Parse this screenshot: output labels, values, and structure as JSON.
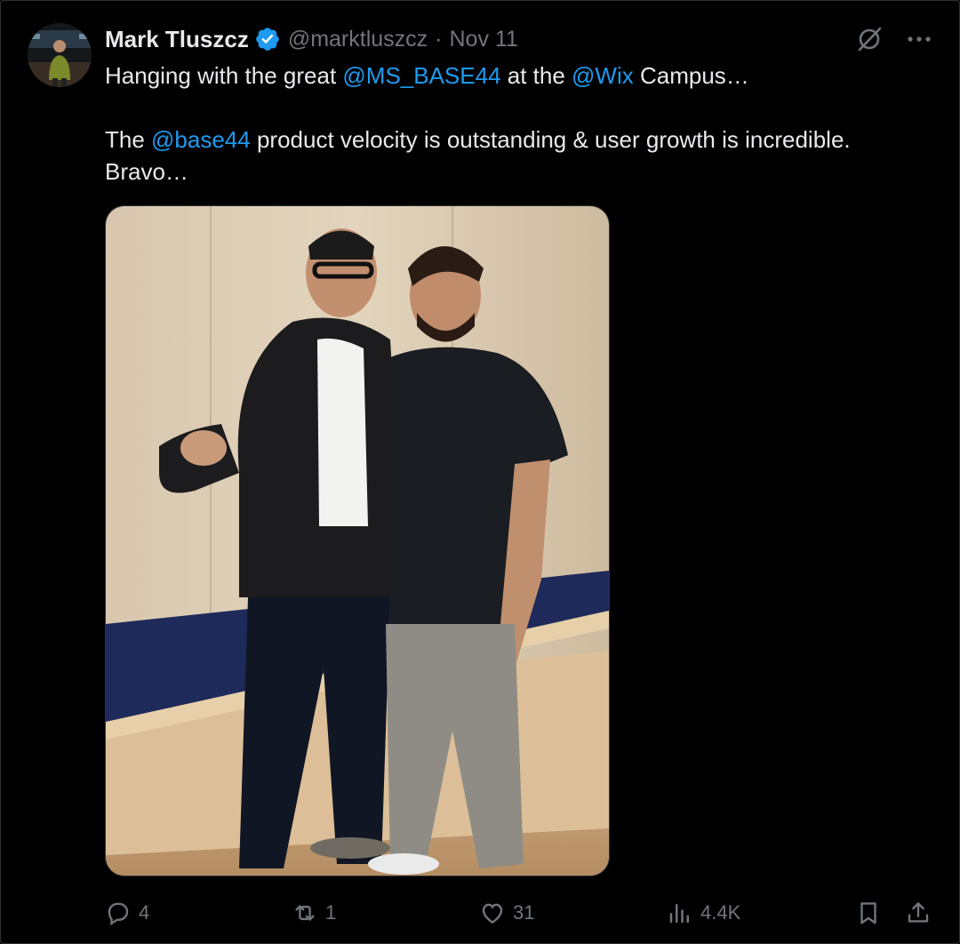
{
  "author": {
    "name": "Mark Tluszcz",
    "handle": "@marktluszcz",
    "separator": "·",
    "date": "Nov 11",
    "verified": true
  },
  "tweet": {
    "line1": {
      "before_1": "Hanging with the great ",
      "mention_1": "@MS_BASE44",
      "middle": " at the ",
      "mention_2": "@Wix",
      "after": " Campus…"
    },
    "line2": {
      "before": "The ",
      "mention": "@base44",
      "after": " product velocity is outstanding & user growth is incredible. Bravo…"
    }
  },
  "media": {
    "description_icon": "photo"
  },
  "actions": {
    "replies": "4",
    "reposts": "1",
    "likes": "31",
    "views": "4.4K"
  },
  "colors": {
    "background": "#000000",
    "text": "#e7e9ea",
    "secondary": "#71767b",
    "accent": "#1d9bf0"
  },
  "icons": [
    "verified-badge-icon",
    "grok-icon",
    "more-icon",
    "reply-icon",
    "repost-icon",
    "like-icon",
    "views-icon",
    "bookmark-icon",
    "share-icon"
  ]
}
